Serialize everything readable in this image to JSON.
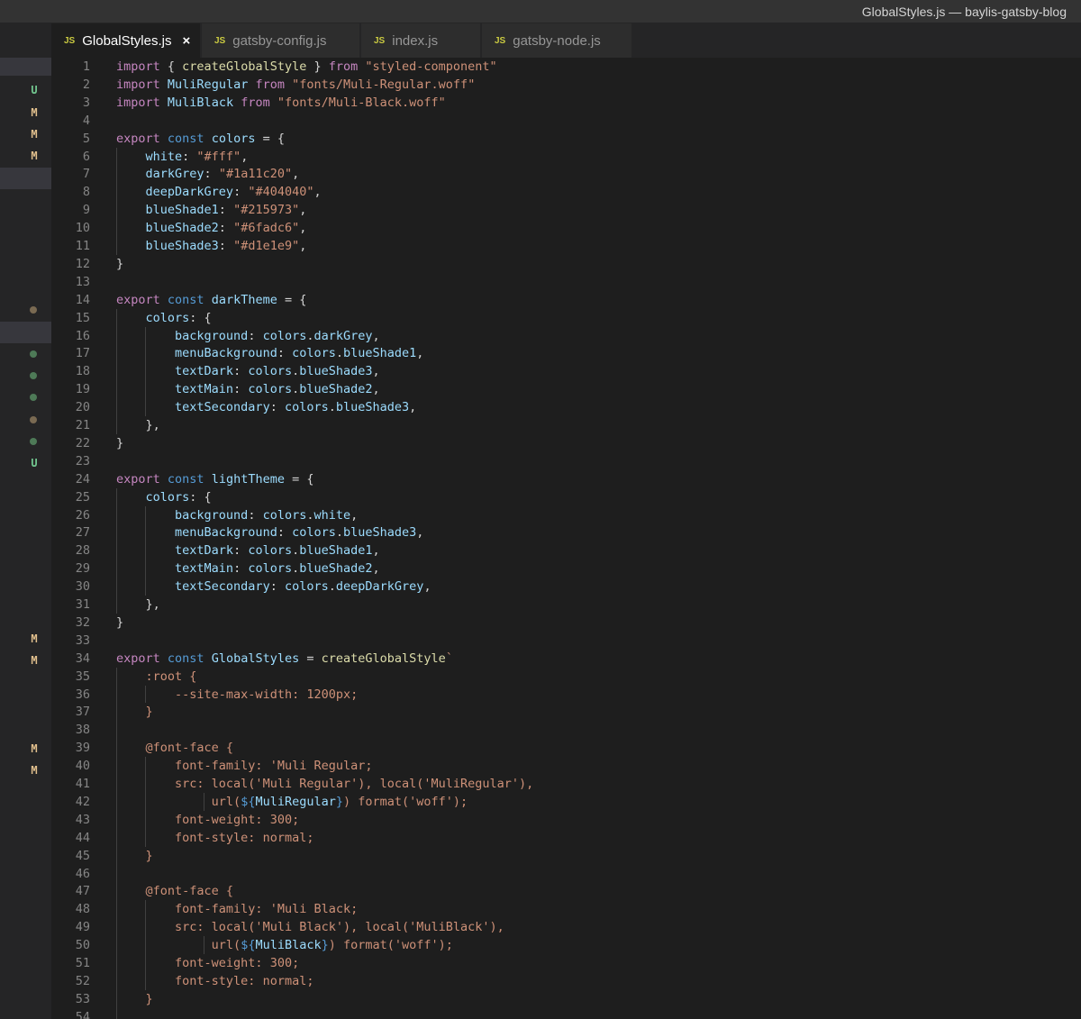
{
  "window": {
    "title": "GlobalStyles.js — baylis-gatsby-blog"
  },
  "tabs": [
    {
      "label": "GlobalStyles.js",
      "icon": "JS",
      "active": true,
      "close": "×"
    },
    {
      "label": "gatsby-config.js",
      "icon": "JS",
      "active": false
    },
    {
      "label": "index.js",
      "icon": "JS",
      "active": false
    },
    {
      "label": "gatsby-node.js",
      "icon": "JS",
      "active": false
    }
  ],
  "git_gutter": [
    {
      "row": 2,
      "mark": "U"
    },
    {
      "row": 3,
      "mark": "M"
    },
    {
      "row": 4,
      "mark": "M"
    },
    {
      "row": 5,
      "mark": "M"
    },
    {
      "row": 12,
      "dot": "#7a6a52"
    },
    {
      "row": 14,
      "dot": "#4e7a57"
    },
    {
      "row": 15,
      "dot": "#4e7a57"
    },
    {
      "row": 16,
      "dot": "#4e7a57"
    },
    {
      "row": 17,
      "dot": "#7a6a52"
    },
    {
      "row": 18,
      "dot": "#4e7a57"
    },
    {
      "row": 19,
      "mark": "U"
    },
    {
      "row": 27,
      "mark": "M"
    },
    {
      "row": 28,
      "mark": "M"
    },
    {
      "row": 32,
      "mark": "M"
    },
    {
      "row": 33,
      "mark": "M"
    }
  ],
  "colors": {
    "background": "#1e1e1e",
    "keyword": "#c586c0",
    "storage": "#569cd6",
    "function": "#dcdcaa",
    "variable": "#9cdcfe",
    "string": "#ce9178"
  },
  "code_lines": [
    [
      [
        "kw",
        "import"
      ],
      [
        "p",
        " { "
      ],
      [
        "fn",
        "createGlobalStyle"
      ],
      [
        "p",
        " } "
      ],
      [
        "kw",
        "from"
      ],
      [
        "p",
        " "
      ],
      [
        "str",
        "\"styled-component\""
      ]
    ],
    [
      [
        "kw",
        "import"
      ],
      [
        "p",
        " "
      ],
      [
        "var",
        "MuliRegular"
      ],
      [
        "p",
        " "
      ],
      [
        "kw",
        "from"
      ],
      [
        "p",
        " "
      ],
      [
        "str",
        "\"fonts/Muli-Regular.woff\""
      ]
    ],
    [
      [
        "kw",
        "import"
      ],
      [
        "p",
        " "
      ],
      [
        "var",
        "MuliBlack"
      ],
      [
        "p",
        " "
      ],
      [
        "kw",
        "from"
      ],
      [
        "p",
        " "
      ],
      [
        "str",
        "\"fonts/Muli-Black.woff\""
      ]
    ],
    [],
    [
      [
        "kw",
        "export"
      ],
      [
        "p",
        " "
      ],
      [
        "st",
        "const"
      ],
      [
        "p",
        " "
      ],
      [
        "var",
        "colors"
      ],
      [
        "p",
        " = {"
      ]
    ],
    [
      [
        "p",
        "    "
      ],
      [
        "prop",
        "white"
      ],
      [
        "p",
        ": "
      ],
      [
        "str",
        "\"#fff\""
      ],
      [
        "p",
        ","
      ]
    ],
    [
      [
        "p",
        "    "
      ],
      [
        "prop",
        "darkGrey"
      ],
      [
        "p",
        ": "
      ],
      [
        "str",
        "\"#1a11c20\""
      ],
      [
        "p",
        ","
      ]
    ],
    [
      [
        "p",
        "    "
      ],
      [
        "prop",
        "deepDarkGrey"
      ],
      [
        "p",
        ": "
      ],
      [
        "str",
        "\"#404040\""
      ],
      [
        "p",
        ","
      ]
    ],
    [
      [
        "p",
        "    "
      ],
      [
        "prop",
        "blueShade1"
      ],
      [
        "p",
        ": "
      ],
      [
        "str",
        "\"#215973\""
      ],
      [
        "p",
        ","
      ]
    ],
    [
      [
        "p",
        "    "
      ],
      [
        "prop",
        "blueShade2"
      ],
      [
        "p",
        ": "
      ],
      [
        "str",
        "\"#6fadc6\""
      ],
      [
        "p",
        ","
      ]
    ],
    [
      [
        "p",
        "    "
      ],
      [
        "prop",
        "blueShade3"
      ],
      [
        "p",
        ": "
      ],
      [
        "str",
        "\"#d1e1e9\""
      ],
      [
        "p",
        ","
      ]
    ],
    [
      [
        "p",
        "}"
      ]
    ],
    [],
    [
      [
        "kw",
        "export"
      ],
      [
        "p",
        " "
      ],
      [
        "st",
        "const"
      ],
      [
        "p",
        " "
      ],
      [
        "var",
        "darkTheme"
      ],
      [
        "p",
        " = {"
      ]
    ],
    [
      [
        "p",
        "    "
      ],
      [
        "prop",
        "colors"
      ],
      [
        "p",
        ": {"
      ]
    ],
    [
      [
        "p",
        "        "
      ],
      [
        "prop",
        "background"
      ],
      [
        "p",
        ": "
      ],
      [
        "var",
        "colors"
      ],
      [
        "p",
        "."
      ],
      [
        "var",
        "darkGrey"
      ],
      [
        "p",
        ","
      ]
    ],
    [
      [
        "p",
        "        "
      ],
      [
        "prop",
        "menuBackground"
      ],
      [
        "p",
        ": "
      ],
      [
        "var",
        "colors"
      ],
      [
        "p",
        "."
      ],
      [
        "var",
        "blueShade1"
      ],
      [
        "p",
        ","
      ]
    ],
    [
      [
        "p",
        "        "
      ],
      [
        "prop",
        "textDark"
      ],
      [
        "p",
        ": "
      ],
      [
        "var",
        "colors"
      ],
      [
        "p",
        "."
      ],
      [
        "var",
        "blueShade3"
      ],
      [
        "p",
        ","
      ]
    ],
    [
      [
        "p",
        "        "
      ],
      [
        "prop",
        "textMain"
      ],
      [
        "p",
        ": "
      ],
      [
        "var",
        "colors"
      ],
      [
        "p",
        "."
      ],
      [
        "var",
        "blueShade2"
      ],
      [
        "p",
        ","
      ]
    ],
    [
      [
        "p",
        "        "
      ],
      [
        "prop",
        "textSecondary"
      ],
      [
        "p",
        ": "
      ],
      [
        "var",
        "colors"
      ],
      [
        "p",
        "."
      ],
      [
        "var",
        "blueShade3"
      ],
      [
        "p",
        ","
      ]
    ],
    [
      [
        "p",
        "    },"
      ]
    ],
    [
      [
        "p",
        "}"
      ]
    ],
    [],
    [
      [
        "kw",
        "export"
      ],
      [
        "p",
        " "
      ],
      [
        "st",
        "const"
      ],
      [
        "p",
        " "
      ],
      [
        "var",
        "lightTheme"
      ],
      [
        "p",
        " = {"
      ]
    ],
    [
      [
        "p",
        "    "
      ],
      [
        "prop",
        "colors"
      ],
      [
        "p",
        ": {"
      ]
    ],
    [
      [
        "p",
        "        "
      ],
      [
        "prop",
        "background"
      ],
      [
        "p",
        ": "
      ],
      [
        "var",
        "colors"
      ],
      [
        "p",
        "."
      ],
      [
        "var",
        "white"
      ],
      [
        "p",
        ","
      ]
    ],
    [
      [
        "p",
        "        "
      ],
      [
        "prop",
        "menuBackground"
      ],
      [
        "p",
        ": "
      ],
      [
        "var",
        "colors"
      ],
      [
        "p",
        "."
      ],
      [
        "var",
        "blueShade3"
      ],
      [
        "p",
        ","
      ]
    ],
    [
      [
        "p",
        "        "
      ],
      [
        "prop",
        "textDark"
      ],
      [
        "p",
        ": "
      ],
      [
        "var",
        "colors"
      ],
      [
        "p",
        "."
      ],
      [
        "var",
        "blueShade1"
      ],
      [
        "p",
        ","
      ]
    ],
    [
      [
        "p",
        "        "
      ],
      [
        "prop",
        "textMain"
      ],
      [
        "p",
        ": "
      ],
      [
        "var",
        "colors"
      ],
      [
        "p",
        "."
      ],
      [
        "var",
        "blueShade2"
      ],
      [
        "p",
        ","
      ]
    ],
    [
      [
        "p",
        "        "
      ],
      [
        "prop",
        "textSecondary"
      ],
      [
        "p",
        ": "
      ],
      [
        "var",
        "colors"
      ],
      [
        "p",
        "."
      ],
      [
        "var",
        "deepDarkGrey"
      ],
      [
        "p",
        ","
      ]
    ],
    [
      [
        "p",
        "    },"
      ]
    ],
    [
      [
        "p",
        "}"
      ]
    ],
    [],
    [
      [
        "kw",
        "export"
      ],
      [
        "p",
        " "
      ],
      [
        "st",
        "const"
      ],
      [
        "p",
        " "
      ],
      [
        "var",
        "GlobalStyles"
      ],
      [
        "p",
        " = "
      ],
      [
        "fn",
        "createGlobalStyle"
      ],
      [
        "str",
        "`"
      ]
    ],
    [
      [
        "p",
        "    "
      ],
      [
        "css",
        ":root {"
      ]
    ],
    [
      [
        "p",
        "        "
      ],
      [
        "css",
        "--site-max-width: 1200px;"
      ]
    ],
    [
      [
        "p",
        "    "
      ],
      [
        "css",
        "}"
      ]
    ],
    [],
    [
      [
        "p",
        "    "
      ],
      [
        "css",
        "@font-face {"
      ]
    ],
    [
      [
        "p",
        "        "
      ],
      [
        "css",
        "font-family: 'Muli Regular;"
      ]
    ],
    [
      [
        "p",
        "        "
      ],
      [
        "css",
        "src: local('Muli Regular'), local('MuliRegular'),"
      ]
    ],
    [
      [
        "p",
        "             "
      ],
      [
        "css",
        "url("
      ],
      [
        "tmpl",
        "${"
      ],
      [
        "var",
        "MuliRegular"
      ],
      [
        "tmpl",
        "}"
      ],
      [
        "css",
        ") format('woff');"
      ]
    ],
    [
      [
        "p",
        "        "
      ],
      [
        "css",
        "font-weight: 300;"
      ]
    ],
    [
      [
        "p",
        "        "
      ],
      [
        "css",
        "font-style: normal;"
      ]
    ],
    [
      [
        "p",
        "    "
      ],
      [
        "css",
        "}"
      ]
    ],
    [],
    [
      [
        "p",
        "    "
      ],
      [
        "css",
        "@font-face {"
      ]
    ],
    [
      [
        "p",
        "        "
      ],
      [
        "css",
        "font-family: 'Muli Black;"
      ]
    ],
    [
      [
        "p",
        "        "
      ],
      [
        "css",
        "src: local('Muli Black'), local('MuliBlack'),"
      ]
    ],
    [
      [
        "p",
        "             "
      ],
      [
        "css",
        "url("
      ],
      [
        "tmpl",
        "${"
      ],
      [
        "var",
        "MuliBlack"
      ],
      [
        "tmpl",
        "}"
      ],
      [
        "css",
        ") format('woff');"
      ]
    ],
    [
      [
        "p",
        "        "
      ],
      [
        "css",
        "font-weight: 300;"
      ]
    ],
    [
      [
        "p",
        "        "
      ],
      [
        "css",
        "font-style: normal;"
      ]
    ],
    [
      [
        "p",
        "    "
      ],
      [
        "css",
        "}"
      ]
    ],
    []
  ]
}
